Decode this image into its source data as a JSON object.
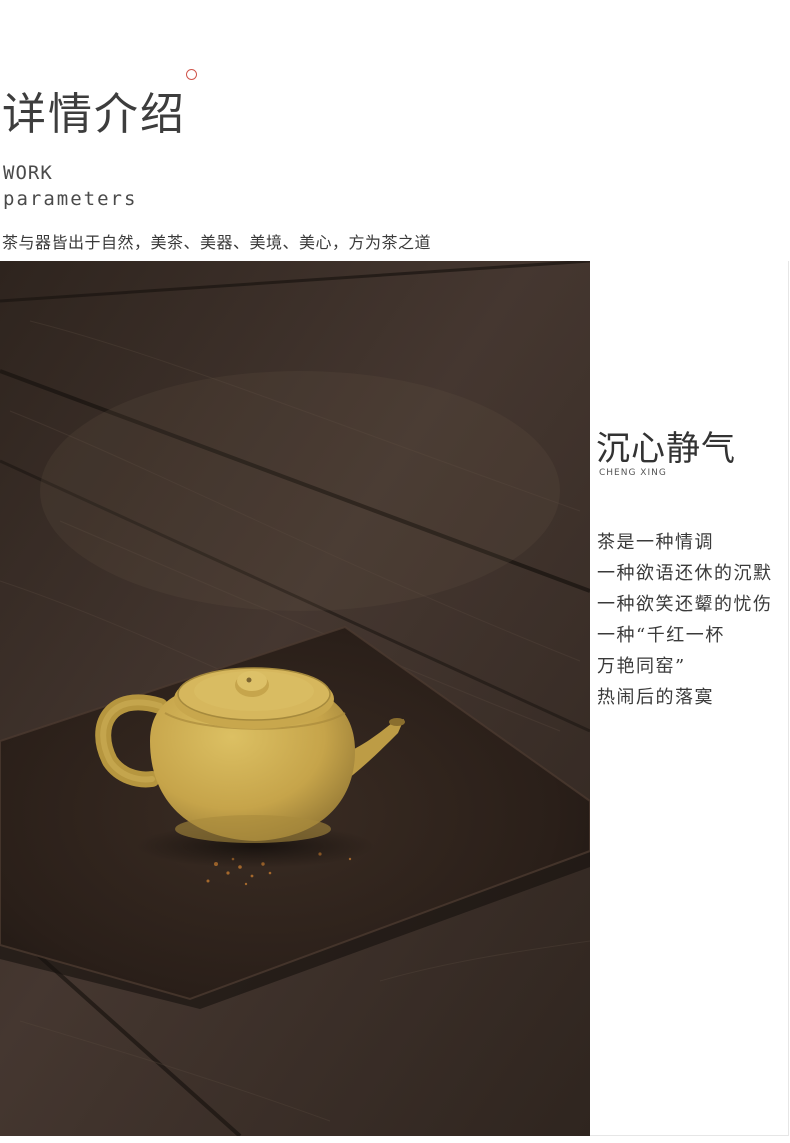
{
  "header": {
    "title": "详情介绍",
    "work": "WORK",
    "parameters": "parameters",
    "tagline": "茶与器皆出于自然，美茶、美器、美境、美心，方为茶之道"
  },
  "side": {
    "title": "沉心静气",
    "subtitle": "CHENG XING",
    "poem": [
      "茶是一种情调",
      "一种欲语还休的沉默",
      "一种欲笑还颦的忧伤",
      "一种“千红一杯",
      "万艳同窑”",
      "热闹后的落寞"
    ]
  },
  "colors": {
    "accent_dot": "#d0564c",
    "wood": "#3b2f27",
    "tray": "#2a211c",
    "teapot": "#c9a84e"
  }
}
